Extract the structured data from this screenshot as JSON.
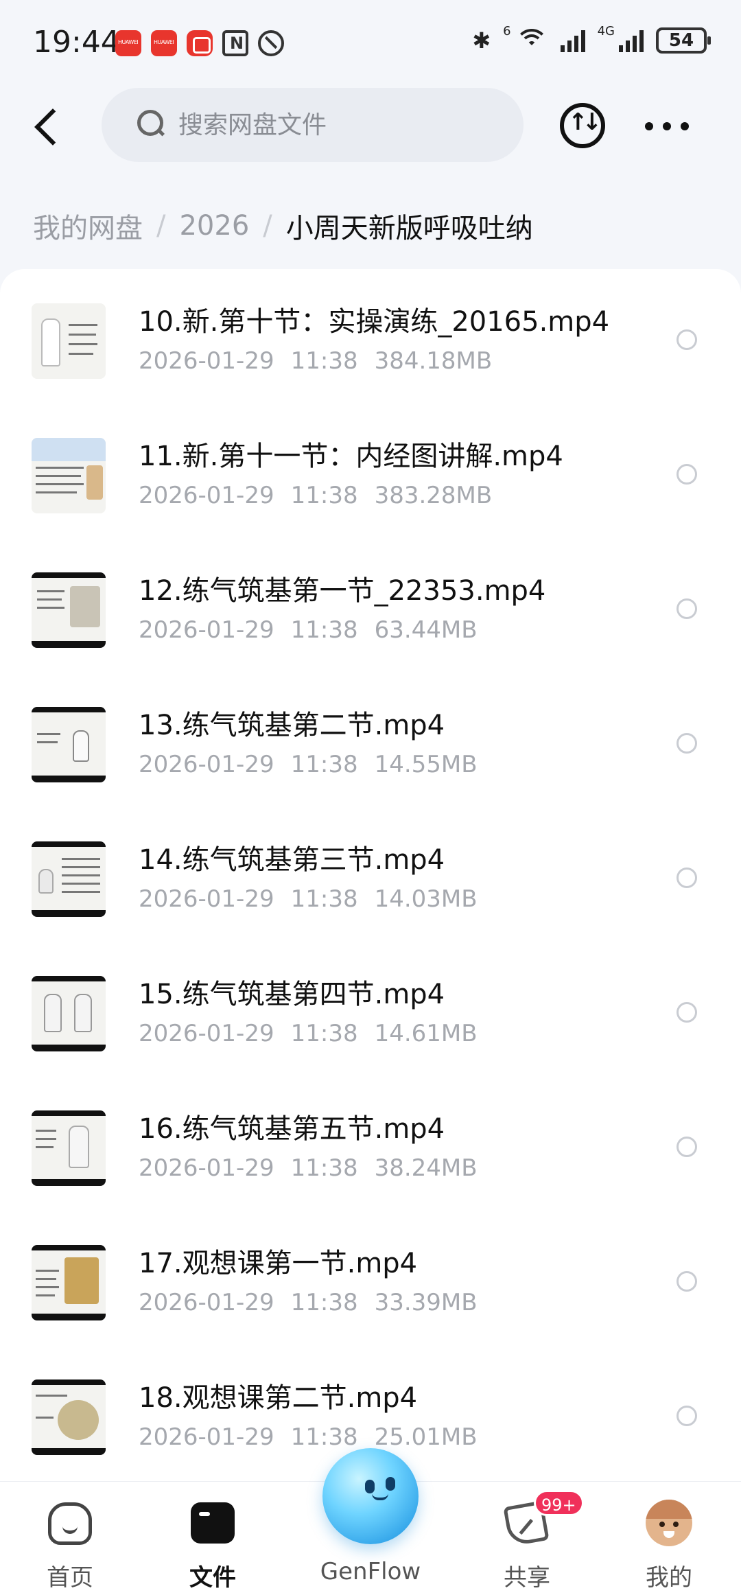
{
  "status_bar": {
    "time": "19:44",
    "battery": "54",
    "signal_label": "4G",
    "wifi_label": "6"
  },
  "header": {
    "search_placeholder": "搜索网盘文件"
  },
  "breadcrumb": {
    "items": [
      "我的网盘",
      "2026",
      "小周天新版呼吸吐纳"
    ],
    "separator": "/"
  },
  "files": [
    {
      "name": "10.新.第十节：实操演练_20165.mp4",
      "date": "2026-01-29",
      "time": "11:38",
      "size": "384.18MB"
    },
    {
      "name": "11.新.第十一节：内经图讲解.mp4",
      "date": "2026-01-29",
      "time": "11:38",
      "size": "383.28MB"
    },
    {
      "name": "12.练气筑基第一节_22353.mp4",
      "date": "2026-01-29",
      "time": "11:38",
      "size": "63.44MB"
    },
    {
      "name": "13.练气筑基第二节.mp4",
      "date": "2026-01-29",
      "time": "11:38",
      "size": "14.55MB"
    },
    {
      "name": "14.练气筑基第三节.mp4",
      "date": "2026-01-29",
      "time": "11:38",
      "size": "14.03MB"
    },
    {
      "name": "15.练气筑基第四节.mp4",
      "date": "2026-01-29",
      "time": "11:38",
      "size": "14.61MB"
    },
    {
      "name": "16.练气筑基第五节.mp4",
      "date": "2026-01-29",
      "time": "11:38",
      "size": "38.24MB"
    },
    {
      "name": "17.观想课第一节.mp4",
      "date": "2026-01-29",
      "time": "11:38",
      "size": "33.39MB"
    },
    {
      "name": "18.观想课第二节.mp4",
      "date": "2026-01-29",
      "time": "11:38",
      "size": "25.01MB"
    }
  ],
  "bottom_nav": {
    "home": "首页",
    "files": "文件",
    "genflow": "GenFlow",
    "share": "共享",
    "share_badge": "99+",
    "me": "我的"
  },
  "colors": {
    "badge": "#f0305a",
    "meta_text": "#a5a8ae",
    "search_bg": "#e9ecf2"
  }
}
